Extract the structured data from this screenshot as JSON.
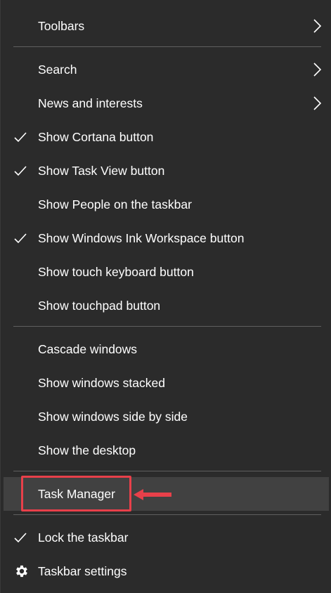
{
  "colors": {
    "background": "#2b2b2b",
    "hover": "#414141",
    "separator": "#5f5f5f",
    "text": "#ffffff",
    "annotation": "#e8404a"
  },
  "menu": {
    "toolbars": {
      "label": "Toolbars",
      "icon": "chevron-right-icon"
    },
    "search": {
      "label": "Search",
      "icon": "chevron-right-icon"
    },
    "news": {
      "label": "News and interests",
      "icon": "chevron-right-icon"
    },
    "cortana": {
      "label": "Show Cortana button",
      "checked": true
    },
    "taskview": {
      "label": "Show Task View button",
      "checked": true
    },
    "people": {
      "label": "Show People on the taskbar",
      "checked": false
    },
    "ink": {
      "label": "Show Windows Ink Workspace button",
      "checked": true
    },
    "touch_keyboard": {
      "label": "Show touch keyboard button",
      "checked": false
    },
    "touchpad": {
      "label": "Show touchpad button",
      "checked": false
    },
    "cascade": {
      "label": "Cascade windows"
    },
    "stacked": {
      "label": "Show windows stacked"
    },
    "side_by_side": {
      "label": "Show windows side by side"
    },
    "desktop": {
      "label": "Show the desktop"
    },
    "task_manager": {
      "label": "Task Manager",
      "highlighted": true
    },
    "lock": {
      "label": "Lock the taskbar",
      "checked": true
    },
    "settings": {
      "label": "Taskbar settings",
      "icon": "gear-icon"
    }
  }
}
